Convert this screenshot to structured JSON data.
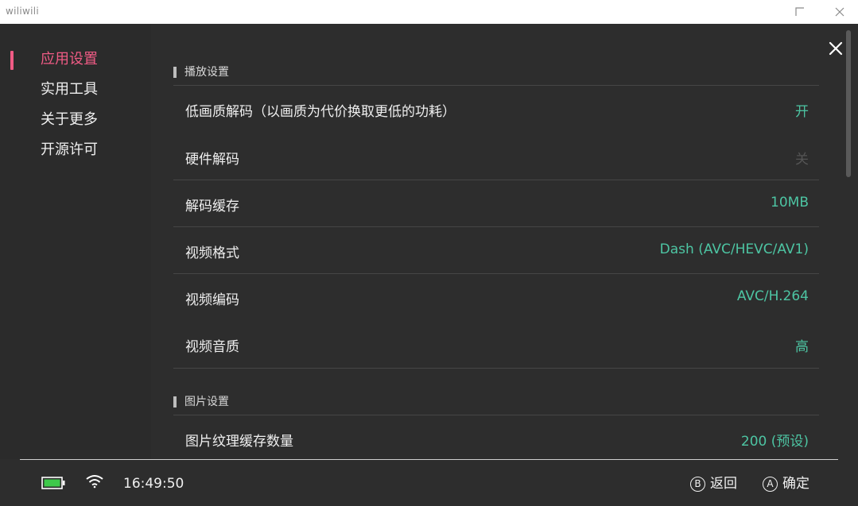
{
  "window": {
    "title": "wiliwili"
  },
  "sidebar": {
    "items": [
      {
        "label": "应用设置",
        "active": true
      },
      {
        "label": "实用工具",
        "active": false
      },
      {
        "label": "关于更多",
        "active": false
      },
      {
        "label": "开源许可",
        "active": false
      }
    ]
  },
  "sections": {
    "playback": {
      "title": "播放设置",
      "rows": [
        {
          "label": "低画质解码（以画质为代价换取更低的功耗）",
          "value": "开"
        },
        {
          "label": "硬件解码",
          "value": "关"
        },
        {
          "label": "解码缓存",
          "value": "10MB"
        },
        {
          "label": "视频格式",
          "value": "Dash (AVC/HEVC/AV1)"
        },
        {
          "label": "视频编码",
          "value": "AVC/H.264"
        },
        {
          "label": "视频音质",
          "value": "高"
        }
      ]
    },
    "image": {
      "title": "图片设置",
      "rows": [
        {
          "label": "图片纹理缓存数量",
          "value": "200 (预设)"
        }
      ]
    }
  },
  "footer": {
    "time": "16:49:50",
    "back_glyph": "B",
    "back_label": "返回",
    "ok_glyph": "A",
    "ok_label": "确定"
  },
  "colors": {
    "accent": "#f05b85",
    "value": "#4dc5a3",
    "value_off": "#555555",
    "background": "#2d2d2d",
    "battery": "#3ec94a"
  },
  "icons": [
    "maximize-icon",
    "window-close-icon",
    "close-icon",
    "battery-icon",
    "wifi-icon"
  ]
}
